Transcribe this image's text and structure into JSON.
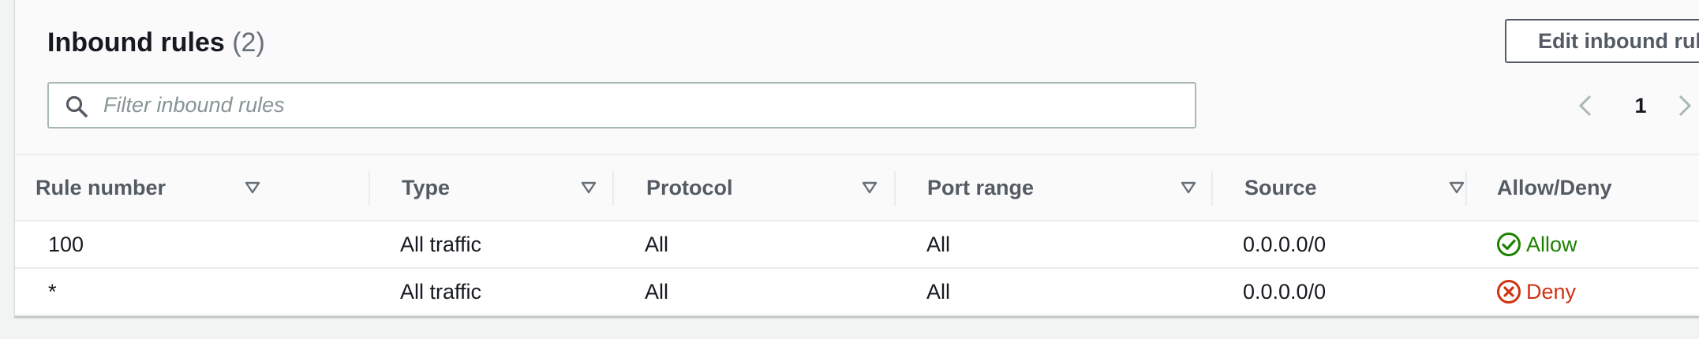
{
  "header": {
    "title": "Inbound rules",
    "count": "(2)",
    "edit_button": "Edit inbound rules"
  },
  "filter": {
    "placeholder": "Filter inbound rules",
    "value": ""
  },
  "pagination": {
    "current_page": "1"
  },
  "table": {
    "columns": [
      "Rule number",
      "Type",
      "Protocol",
      "Port range",
      "Source",
      "Allow/Deny"
    ],
    "rows": [
      {
        "rule_number": "100",
        "type": "All traffic",
        "protocol": "All",
        "port_range": "All",
        "source": "0.0.0.0/0",
        "action": "Allow",
        "action_icon": "check-circle-icon"
      },
      {
        "rule_number": "*",
        "type": "All traffic",
        "protocol": "All",
        "port_range": "All",
        "source": "0.0.0.0/0",
        "action": "Deny",
        "action_icon": "x-circle-icon"
      }
    ]
  },
  "colors": {
    "allow": "#1d8102",
    "deny": "#d13212",
    "text": "#16191f",
    "muted": "#545b64"
  }
}
